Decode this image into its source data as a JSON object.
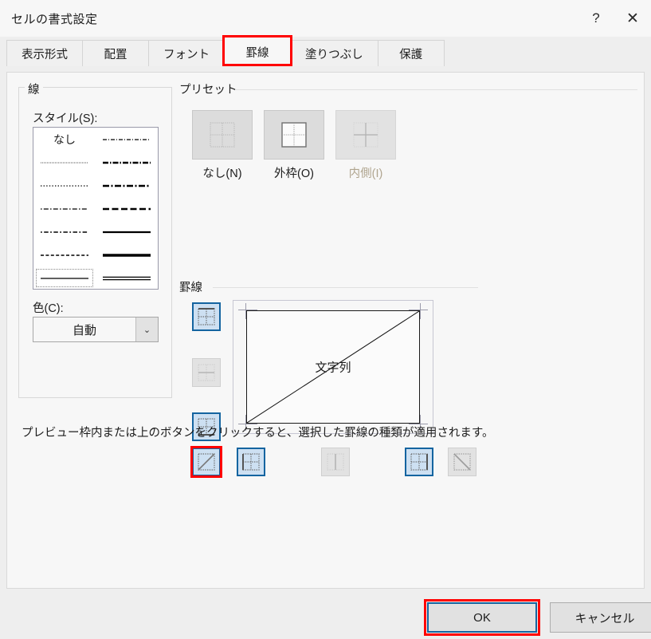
{
  "window": {
    "title": "セルの書式設定",
    "help_icon": "?",
    "close_icon": "✕"
  },
  "tabs": [
    {
      "label": "表示形式",
      "selected": false
    },
    {
      "label": "配置",
      "selected": false
    },
    {
      "label": "フォント",
      "selected": false
    },
    {
      "label": "罫線",
      "selected": true,
      "annotated": true
    },
    {
      "label": "塗りつぶし",
      "selected": false
    },
    {
      "label": "保護",
      "selected": false
    }
  ],
  "line_group": {
    "label": "線",
    "style_label": "スタイル(S):",
    "style_none_label": "なし",
    "color_label": "色(C):",
    "color_value": "自動",
    "color_arrow": "⌄",
    "styles": [
      {
        "name": "none",
        "selected": false
      },
      {
        "name": "dash-dot-dot-thin",
        "selected": false
      },
      {
        "name": "dotted-fine",
        "selected": false
      },
      {
        "name": "dash-dot-dot-medium",
        "selected": false
      },
      {
        "name": "dotted",
        "selected": false
      },
      {
        "name": "dash-dot-medium",
        "selected": false
      },
      {
        "name": "dash-dot-thin",
        "selected": false
      },
      {
        "name": "dashed-medium",
        "selected": false
      },
      {
        "name": "dash-dot-thin-2",
        "selected": false
      },
      {
        "name": "solid-medium",
        "selected": false
      },
      {
        "name": "dashed-thin",
        "selected": false
      },
      {
        "name": "solid-thick",
        "selected": false
      },
      {
        "name": "solid-thin",
        "selected": true
      },
      {
        "name": "double",
        "selected": false
      }
    ]
  },
  "preset": {
    "label": "プリセット",
    "items": [
      {
        "label": "なし(N)",
        "icon": "preset-none-icon",
        "disabled": false
      },
      {
        "label": "外枠(O)",
        "icon": "preset-outline-icon",
        "disabled": false
      },
      {
        "label": "内側(I)",
        "icon": "preset-inside-icon",
        "disabled": true
      }
    ]
  },
  "border": {
    "label": "罫線",
    "preview_text": "文字列",
    "side_buttons": [
      {
        "name": "border-top-button",
        "state": "on"
      },
      {
        "name": "border-middle-horizontal-button",
        "state": "disabled"
      },
      {
        "name": "border-bottom-button",
        "state": "on"
      }
    ],
    "bottom_buttons": [
      {
        "name": "border-diagonal-up-button",
        "state": "on",
        "annotated": true
      },
      {
        "name": "border-left-button",
        "state": "on",
        "annotated": false
      },
      {
        "name": "border-middle-vertical-button",
        "state": "disabled",
        "annotated": false
      },
      {
        "name": "border-right-button",
        "state": "on",
        "annotated": false
      },
      {
        "name": "border-diagonal-down-button",
        "state": "off",
        "annotated": false
      }
    ]
  },
  "hint": "プレビュー枠内または上のボタンをクリックすると、選択した罫線の種類が適用されます。",
  "footer": {
    "ok_label": "OK",
    "cancel_label": "キャンセル"
  },
  "colors": {
    "annotation_red": "#ff0000",
    "selection_blue": "#1464a0",
    "selection_fill": "#cde0f2",
    "dialog_bg": "#f7f7f7"
  }
}
